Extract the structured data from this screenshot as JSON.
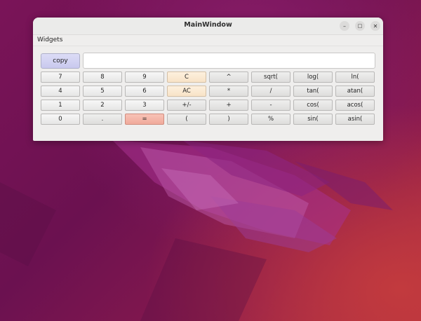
{
  "window": {
    "title": "MainWindow",
    "controls": {
      "minimize": "–",
      "maximize": "□",
      "close": "✕"
    }
  },
  "menubar": {
    "items": [
      {
        "label": "Widgets"
      }
    ]
  },
  "calculator": {
    "copy_label": "copy",
    "display_value": "",
    "keys": [
      {
        "label": "7",
        "kind": "digit"
      },
      {
        "label": "8",
        "kind": "digit"
      },
      {
        "label": "9",
        "kind": "digit"
      },
      {
        "label": "C",
        "kind": "clear"
      },
      {
        "label": "^",
        "kind": "func"
      },
      {
        "label": "sqrt(",
        "kind": "func"
      },
      {
        "label": "log(",
        "kind": "func"
      },
      {
        "label": "ln(",
        "kind": "func"
      },
      {
        "label": "4",
        "kind": "digit"
      },
      {
        "label": "5",
        "kind": "digit"
      },
      {
        "label": "6",
        "kind": "digit"
      },
      {
        "label": "AC",
        "kind": "clear"
      },
      {
        "label": "*",
        "kind": "func"
      },
      {
        "label": "/",
        "kind": "func"
      },
      {
        "label": "tan(",
        "kind": "func"
      },
      {
        "label": "atan(",
        "kind": "func"
      },
      {
        "label": "1",
        "kind": "digit"
      },
      {
        "label": "2",
        "kind": "digit"
      },
      {
        "label": "3",
        "kind": "digit"
      },
      {
        "label": "+/-",
        "kind": "func"
      },
      {
        "label": "+",
        "kind": "func"
      },
      {
        "label": "-",
        "kind": "func"
      },
      {
        "label": "cos(",
        "kind": "func"
      },
      {
        "label": "acos(",
        "kind": "func"
      },
      {
        "label": "0",
        "kind": "digit"
      },
      {
        "label": ".",
        "kind": "func"
      },
      {
        "label": "=",
        "kind": "equals"
      },
      {
        "label": "(",
        "kind": "func"
      },
      {
        "label": ")",
        "kind": "func"
      },
      {
        "label": "%",
        "kind": "func"
      },
      {
        "label": "sin(",
        "kind": "func"
      },
      {
        "label": "asin(",
        "kind": "func"
      }
    ]
  },
  "colors": {
    "copy_button": "#d3d3f3",
    "clear_keys": "#fbe9d3",
    "equals_key": "#f4b5a7",
    "wallpaper_base": "#7a1458"
  }
}
